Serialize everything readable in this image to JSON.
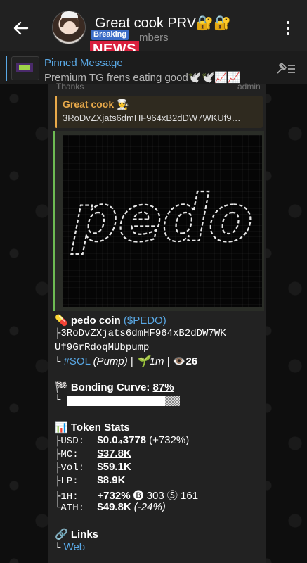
{
  "header": {
    "title": "Great cook PRV🔐🔐",
    "subtitle": "mbers",
    "badge_small": "Breaking",
    "badge_big": "NEWS"
  },
  "pinned": {
    "label": "Pinned Message",
    "text": "Premium TG frens eating good🕊️🕊️📈📈"
  },
  "message": {
    "top_fragment": "Thanks",
    "top_fragment_right": "admin",
    "reply": {
      "name": "Great cook 👨‍🍳",
      "text": "3RoDvZXjats6dmHF964xB2dDW7WKUf9…"
    },
    "media_art": "pedo",
    "coin_emoji": "💊",
    "coin_name": "pedo coin",
    "coin_ticker": "($PEDO)",
    "ca_prefix": "├",
    "ca_line1": "3RoDvZXjats6dmHF964xB2dDW7WK",
    "ca_line2": "Uf9GrRdoqMUbpump",
    "meta_prefix": "└",
    "chain": "#SOL",
    "source": "(Pump)",
    "sep1": "|",
    "age": "🌱1m",
    "sep2": "|",
    "views": "👁️26",
    "bonding_label": "🏁 Bonding Curve:",
    "bonding_value": "87%",
    "bonding_fraction": 0.87,
    "stats_title": "📊 Token Stats",
    "stats": [
      {
        "prefix": "├",
        "key": "USD:",
        "value": "$0.0₄3778",
        "extra": "(+732%)"
      },
      {
        "prefix": "├",
        "key": "MC:",
        "value": "$37.8K",
        "extra": ""
      },
      {
        "prefix": "├",
        "key": "Vol:",
        "value": "$59.1K",
        "extra": ""
      },
      {
        "prefix": "├",
        "key": "LP:",
        "value": "$8.9K",
        "extra": ""
      },
      {
        "prefix": "├",
        "key": "1H:",
        "value": "+732%",
        "extra": "🅑 303 Ⓢ 161"
      },
      {
        "prefix": "└",
        "key": "ATH:",
        "value": "$49.8K",
        "extra": "(-24%)"
      }
    ],
    "links_title": "🔗 Links",
    "links_prefix": "└",
    "web_link": "Web"
  },
  "colors": {
    "accent": "#5aa9e6",
    "reply_accent": "#e8a94a",
    "media_accent": "#6dbb53",
    "badge_red": "#d8203d",
    "badge_blue": "#3b6cc7"
  }
}
